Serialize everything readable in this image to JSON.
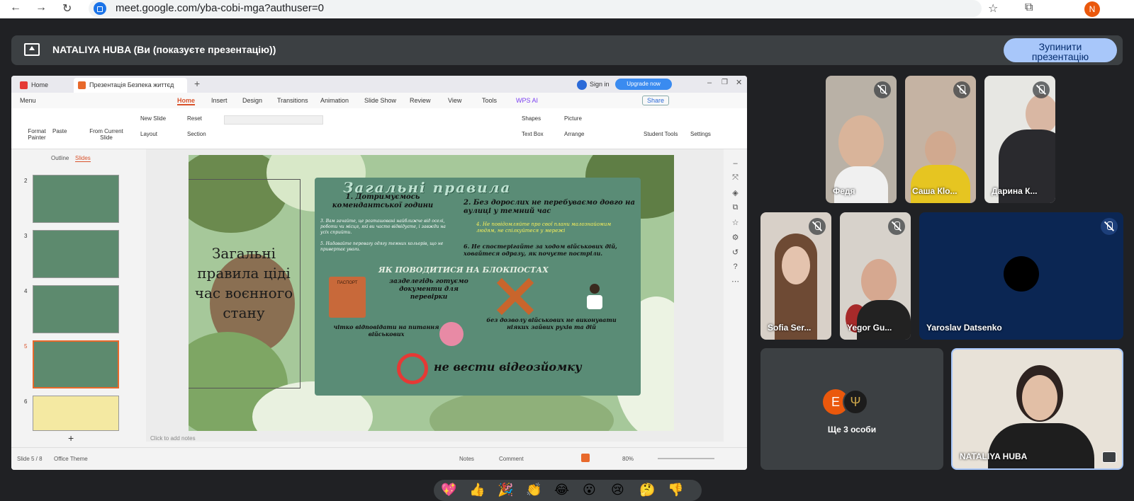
{
  "browser": {
    "back": "←",
    "forward": "→",
    "reload": "↻",
    "url": "meet.google.com/yba-cobi-mga?authuser=0",
    "star": "☆",
    "extensions": "⧉",
    "profile_initial": "N"
  },
  "present_bar": {
    "text": "NATALIYA HUBA (Ви (показуєте презентацію))",
    "stop_line1": "Зупинити",
    "stop_line2": "презентацію"
  },
  "app": {
    "tabs": [
      {
        "label": "Home"
      },
      {
        "label": "Презентація Безпека життєд"
      }
    ],
    "new_tab": "+",
    "sign_in": "Sign in",
    "upgrade": "Upgrade now",
    "menu_label": "Menu",
    "menu_items": [
      "Home",
      "Insert",
      "Design",
      "Transitions",
      "Animation",
      "Slide Show",
      "Review",
      "View",
      "Tools",
      "WPS AI"
    ],
    "share": "Share",
    "ribbon": {
      "format_painter": "Format Painter",
      "paste": "Paste",
      "from_current": "From Current Slide",
      "new_slide": "New Slide",
      "reset": "Reset",
      "layout": "Layout",
      "section": "Section",
      "shapes": "Shapes",
      "picture": "Picture",
      "text_box": "Text Box",
      "arrange": "Arrange",
      "student_tools": "Student Tools",
      "settings": "Settings"
    },
    "panel_tabs": {
      "outline": "Outline",
      "slides": "Slides"
    },
    "thumb_numbers": [
      "2",
      "3",
      "4",
      "5",
      "6"
    ],
    "add_slide": "+",
    "notes_placeholder": "Click to add notes",
    "status": {
      "slide_count": "Slide 5 / 8",
      "theme": "Office Theme",
      "notes": "Notes",
      "comment": "Comment",
      "zoom": "80%"
    }
  },
  "slide": {
    "title": "Загальні правила ціді час воєнного стану",
    "title_lines": [
      "Загальні",
      "правила ціді",
      "час воєнного",
      "стану"
    ],
    "heading": "Загальні правила",
    "rule1": "1. Дотримуємось комендантської години",
    "rule1_sub": "3. Вам зачайте, це розташовані найближче від оселі, роботи чи місця, які ви часто відвідуєте, і завжди на усіх сприйти.",
    "rule1_sub2": "5. Надавайте перевагу одягу темних кольорів, що не привертає уваги.",
    "rule2": "2. Без дорослих не перебуваємо довго на вулиці у темний час",
    "rule4": "4. Не повідомляйте про свої плани малознайомим людям, не спілкуйтеся у мережі",
    "rule6": "6. Не спостерігайте за ходом військових дій, ховайтеся одразу, як почуєте постріли.",
    "checkpoint_title": "ЯК ПОВОДИТИСЯ НА БЛОКПОСТАХ",
    "docs": "зазделегідь готуємо документи для перевірки",
    "answer": "чітко відповідати на питання військових",
    "no_moves": "без дозволу військових не виконувати ніяких зайвих рухів та дій",
    "no_video": "не вести відеозйомку",
    "passport": "ПАСПОРТ"
  },
  "participants": [
    {
      "name": "Федя"
    },
    {
      "name": "Саша Кlo..."
    },
    {
      "name": "Дарина К..."
    },
    {
      "name": "Sofia Ser..."
    },
    {
      "name": "Yegor Gu..."
    },
    {
      "name": "Yaroslav Datsenko"
    },
    {
      "name": "Ще 3 особи",
      "initial": "E"
    },
    {
      "name": "NATALIYA HUBA"
    }
  ],
  "reactions": [
    "💖",
    "👍",
    "🎉",
    "👏",
    "😂",
    "😮",
    "😢",
    "🤔",
    "👎"
  ],
  "colors": {
    "meet_bg": "#202124",
    "stop_button": "#a8c7fa",
    "yaroslav_tile": "#0b2653",
    "avatar_e": "#ea580c",
    "active_border": "#a8c7fa"
  }
}
